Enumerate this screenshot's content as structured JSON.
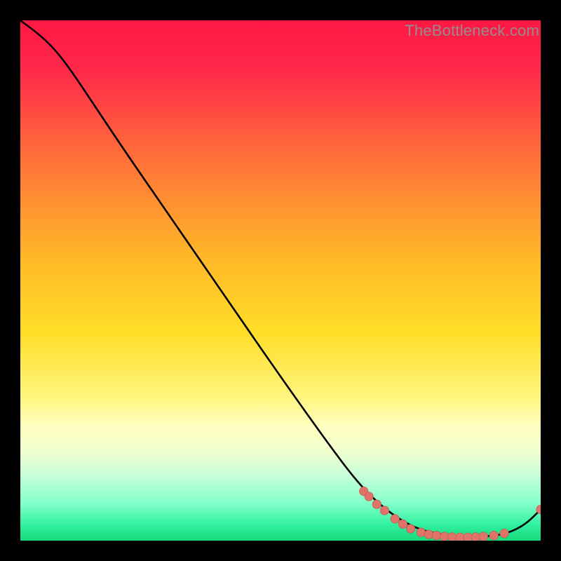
{
  "watermark": "TheBottleneck.com",
  "colors": {
    "background": "#000000",
    "gradient_stops": [
      {
        "offset": "0%",
        "color": "#ff1744"
      },
      {
        "offset": "10%",
        "color": "#ff2a4a"
      },
      {
        "offset": "25%",
        "color": "#ff6a3a"
      },
      {
        "offset": "45%",
        "color": "#ffb628"
      },
      {
        "offset": "60%",
        "color": "#ffde28"
      },
      {
        "offset": "72%",
        "color": "#fff47a"
      },
      {
        "offset": "78%",
        "color": "#ffffc0"
      },
      {
        "offset": "83%",
        "color": "#f0ffd0"
      },
      {
        "offset": "88%",
        "color": "#c0ffd8"
      },
      {
        "offset": "93%",
        "color": "#80ffc8"
      },
      {
        "offset": "97%",
        "color": "#30f0a0"
      },
      {
        "offset": "100%",
        "color": "#16d87a"
      }
    ],
    "curve": "#000000",
    "points_fill": "#e0746b",
    "points_stroke": "#c85a52"
  },
  "chart_data": {
    "type": "line",
    "title": "",
    "xlabel": "",
    "ylabel": "",
    "xlim": [
      0,
      100
    ],
    "ylim": [
      0,
      100
    ],
    "curve": [
      {
        "x": 0,
        "y": 100
      },
      {
        "x": 4,
        "y": 97
      },
      {
        "x": 7,
        "y": 94
      },
      {
        "x": 10,
        "y": 90
      },
      {
        "x": 14,
        "y": 84
      },
      {
        "x": 20,
        "y": 75
      },
      {
        "x": 30,
        "y": 60.5
      },
      {
        "x": 40,
        "y": 46
      },
      {
        "x": 50,
        "y": 31.5
      },
      {
        "x": 60,
        "y": 17.5
      },
      {
        "x": 65,
        "y": 11
      },
      {
        "x": 69,
        "y": 7
      },
      {
        "x": 73,
        "y": 4
      },
      {
        "x": 77,
        "y": 2
      },
      {
        "x": 82,
        "y": 1
      },
      {
        "x": 87,
        "y": 0.7
      },
      {
        "x": 92,
        "y": 1
      },
      {
        "x": 95,
        "y": 2
      },
      {
        "x": 97.5,
        "y": 3.5
      },
      {
        "x": 100,
        "y": 6
      }
    ],
    "points": [
      {
        "x": 66,
        "y": 9.5
      },
      {
        "x": 67,
        "y": 8.5
      },
      {
        "x": 68.5,
        "y": 7.0
      },
      {
        "x": 70,
        "y": 5.8
      },
      {
        "x": 72,
        "y": 4.2
      },
      {
        "x": 73.5,
        "y": 3.2
      },
      {
        "x": 75,
        "y": 2.3
      },
      {
        "x": 77,
        "y": 1.6
      },
      {
        "x": 78.5,
        "y": 1.2
      },
      {
        "x": 80,
        "y": 1.0
      },
      {
        "x": 81.5,
        "y": 0.8
      },
      {
        "x": 83,
        "y": 0.7
      },
      {
        "x": 84.5,
        "y": 0.65
      },
      {
        "x": 86,
        "y": 0.65
      },
      {
        "x": 87.5,
        "y": 0.7
      },
      {
        "x": 89,
        "y": 0.8
      },
      {
        "x": 91,
        "y": 1.0
      },
      {
        "x": 93,
        "y": 1.4
      },
      {
        "x": 100,
        "y": 6.0
      }
    ]
  }
}
